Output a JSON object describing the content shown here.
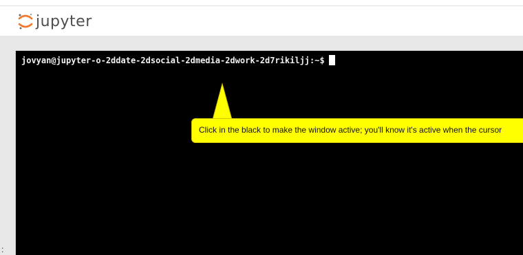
{
  "app": {
    "logo_text": "jupyter",
    "logo_icon": "jupyter-logo-icon",
    "brand_color": "#f37726"
  },
  "terminal": {
    "prompt": "jovyan@jupyter-o-2ddate-2dsocial-2dmedia-2dwork-2d7rikiljj:~$",
    "background": "#000000",
    "text_color": "#f0f0f0"
  },
  "tooltip": {
    "text": "Click in the black to make the window active; you'll know it's active when the cursor",
    "background": "#ffff00"
  },
  "edge_mark": ":"
}
